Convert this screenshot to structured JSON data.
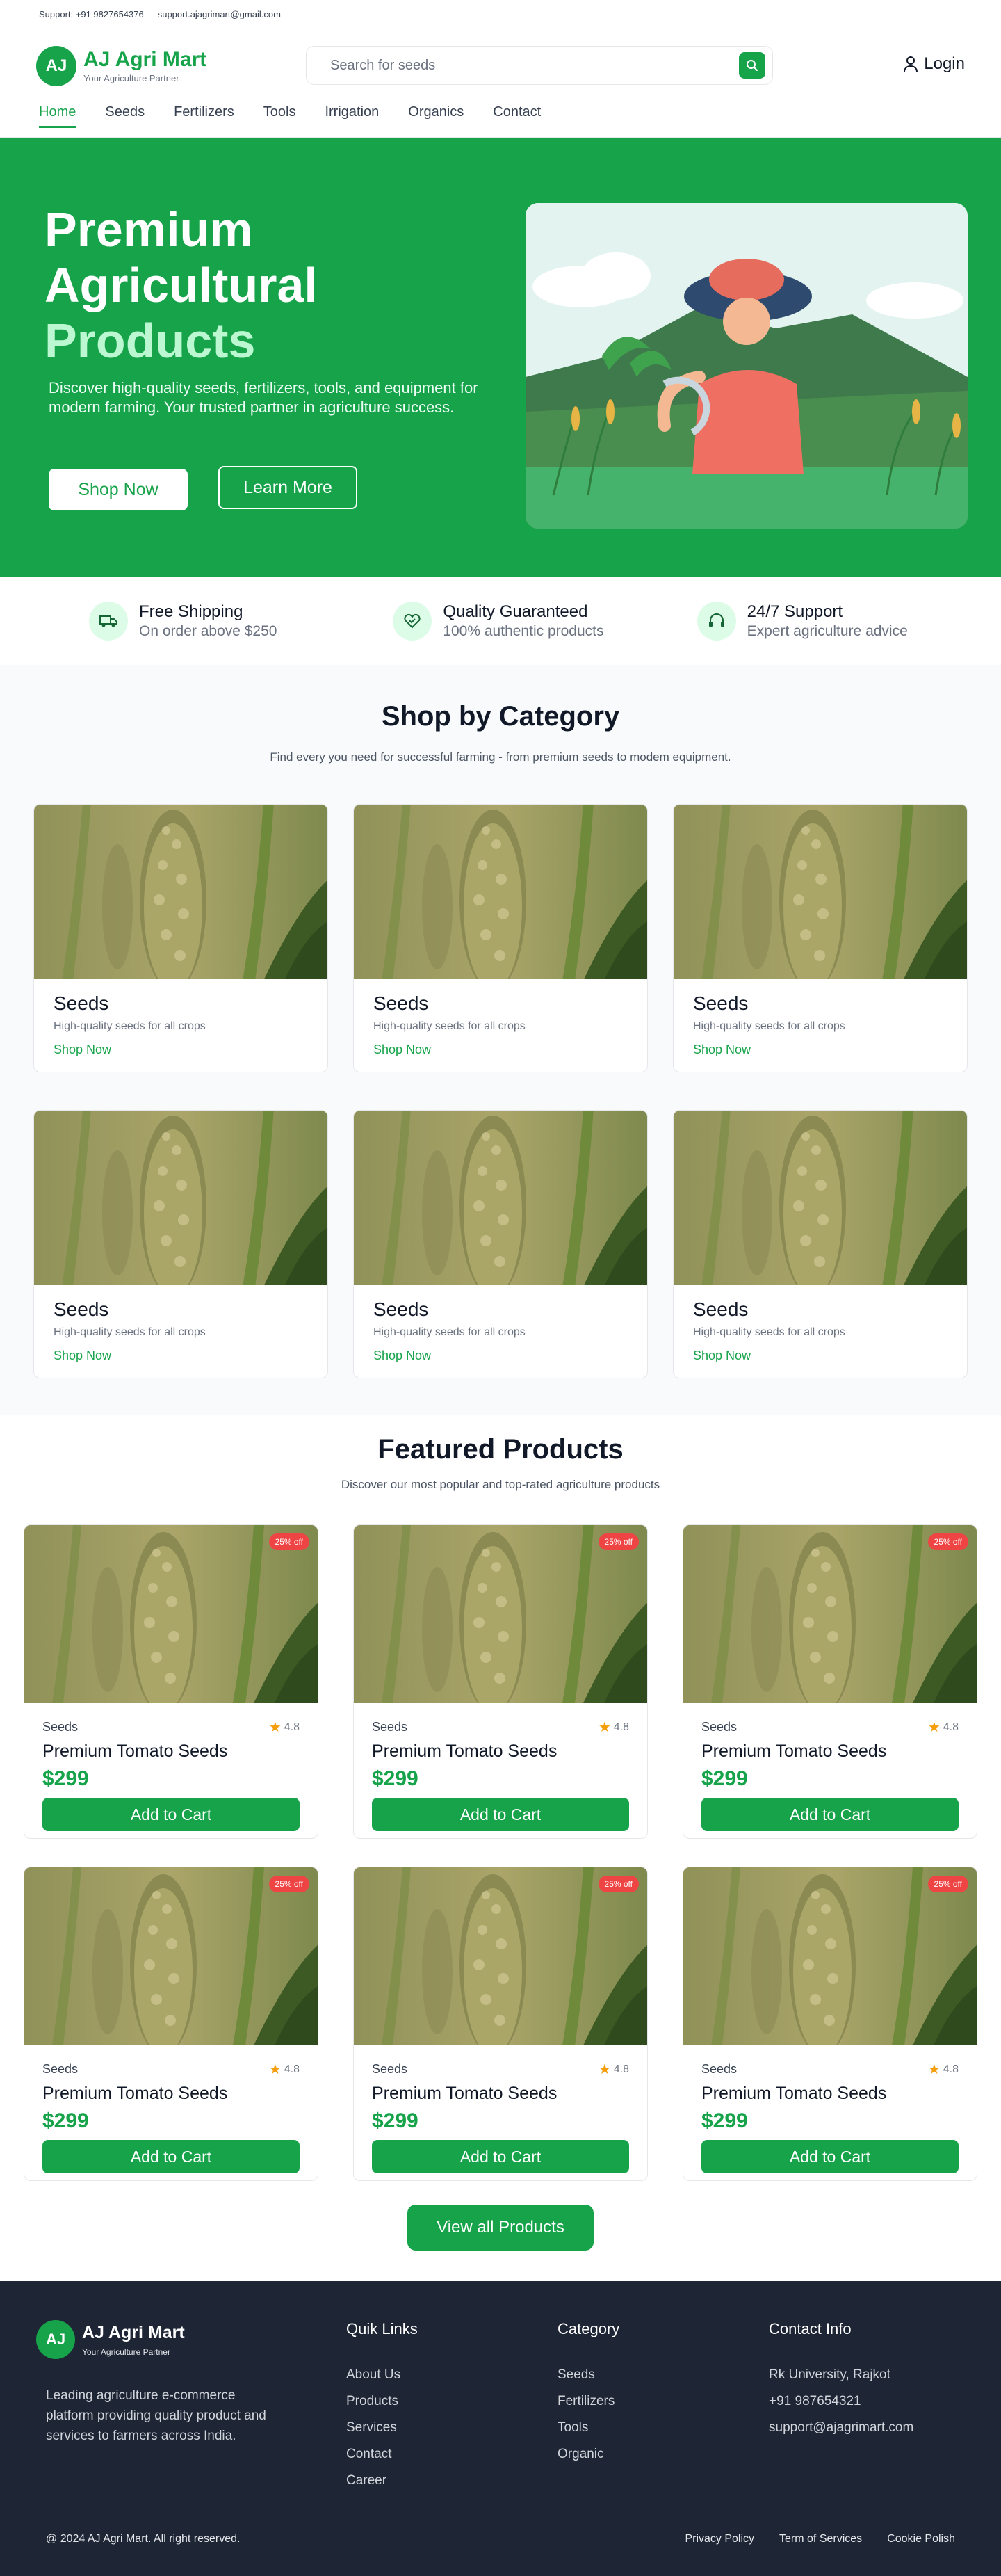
{
  "topbar": {
    "phone": "Support: +91 9827654376",
    "email": "support.ajagrimart@gmail.com"
  },
  "brand": {
    "initials": "AJ",
    "name": "AJ Agri Mart",
    "tagline": "Your Agriculture Partner"
  },
  "search": {
    "placeholder": "Search for seeds",
    "icon": "search-icon"
  },
  "login": {
    "label": "Login",
    "icon": "user-icon"
  },
  "nav": [
    "Home",
    "Seeds",
    "Fertilizers",
    "Tools",
    "Irrigation",
    "Organics",
    "Contact"
  ],
  "nav_active": "Home",
  "hero": {
    "title_line1": "Premium",
    "title_line2": "Agricultural",
    "title_line3": "Products",
    "description": "Discover high-quality seeds, fertilizers, tools, and equipment for modern farming. Your trusted partner in agriculture success.",
    "primary_button": "Shop Now",
    "secondary_button": "Learn More"
  },
  "features": [
    {
      "title": "Free Shipping",
      "subtitle": "On order above  $250",
      "icon": "truck-icon"
    },
    {
      "title": "Quality Guaranteed",
      "subtitle": "100% authentic products",
      "icon": "heart-badge-icon"
    },
    {
      "title": "24/7 Support",
      "subtitle": "Expert agriculture advice",
      "icon": "headset-icon"
    }
  ],
  "categories": {
    "title": "Shop by Category",
    "subtitle": "Find every you need for successful farming  -  from premium seeds to modem equipment.",
    "items": [
      {
        "name": "Seeds",
        "desc": "High-quality seeds for all crops",
        "link": "Shop Now"
      },
      {
        "name": "Seeds",
        "desc": "High-quality seeds for all crops",
        "link": "Shop Now"
      },
      {
        "name": "Seeds",
        "desc": "High-quality seeds for all crops",
        "link": "Shop Now"
      },
      {
        "name": "Seeds",
        "desc": "High-quality seeds for all crops",
        "link": "Shop Now"
      },
      {
        "name": "Seeds",
        "desc": "High-quality seeds for all crops",
        "link": "Shop Now"
      },
      {
        "name": "Seeds",
        "desc": "High-quality seeds for all crops",
        "link": "Shop Now"
      }
    ]
  },
  "featured": {
    "title": "Featured Products",
    "subtitle": "Discover our most popular and top-rated agriculture products",
    "products": [
      {
        "badge": "25% off",
        "category": "Seeds",
        "rating": "4.8",
        "name": "Premium Tomato Seeds",
        "price": "$299",
        "button": "Add to Cart"
      },
      {
        "badge": "25% off",
        "category": "Seeds",
        "rating": "4.8",
        "name": "Premium Tomato Seeds",
        "price": "$299",
        "button": "Add to Cart"
      },
      {
        "badge": "25% off",
        "category": "Seeds",
        "rating": "4.8",
        "name": "Premium Tomato Seeds",
        "price": "$299",
        "button": "Add to Cart"
      },
      {
        "badge": "25% off",
        "category": "Seeds",
        "rating": "4.8",
        "name": "Premium Tomato Seeds",
        "price": "$299",
        "button": "Add to Cart"
      },
      {
        "badge": "25% off",
        "category": "Seeds",
        "rating": "4.8",
        "name": "Premium Tomato Seeds",
        "price": "$299",
        "button": "Add to Cart"
      },
      {
        "badge": "25% off",
        "category": "Seeds",
        "rating": "4.8",
        "name": "Premium Tomato Seeds",
        "price": "$299",
        "button": "Add to Cart"
      }
    ],
    "view_all": "View all Products"
  },
  "footer": {
    "brand": "AJ Agri Mart",
    "initials": "AJ",
    "tagline": "Your Agriculture Partner",
    "about": "Leading agriculture e-commerce platform providing quality product and services to farmers across India.",
    "quick_links": {
      "title": "Quik Links",
      "items": [
        "About Us",
        "Products",
        "Services",
        "Contact",
        "Career"
      ]
    },
    "category": {
      "title": "Category",
      "items": [
        "Seeds",
        "Fertilizers",
        "Tools",
        "Organic"
      ]
    },
    "contact": {
      "title": "Contact Info",
      "items": [
        "Rk University, Rajkot",
        "+91 987654321",
        "support@ajagrimart.com"
      ]
    },
    "copyright": "@ 2024 AJ Agri Mart. All right reserved.",
    "bottom_links": [
      "Privacy Policy",
      "Term of Services",
      "Cookie Polish"
    ]
  },
  "colors": {
    "primary": "#16a34a",
    "hero_bg": "#16a34a",
    "footer_bg": "#1e2535",
    "badge": "#ef4444",
    "star": "#f59e0b"
  }
}
